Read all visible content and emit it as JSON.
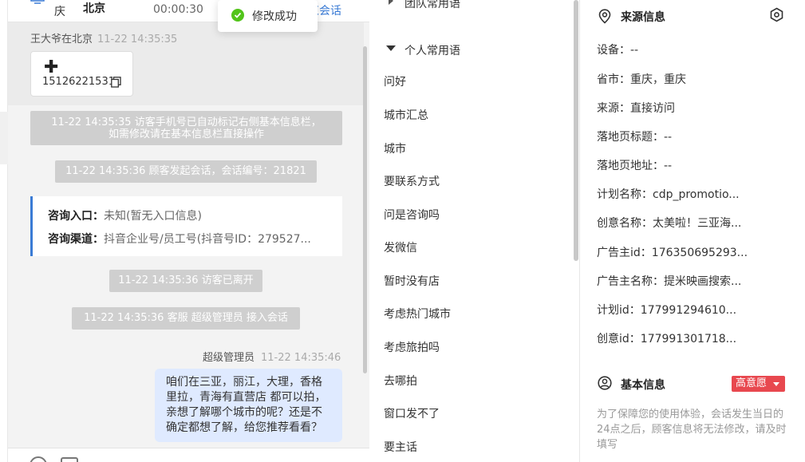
{
  "header": {
    "city_a": "庆",
    "city_b": "北京",
    "timer": "00:00:30",
    "end_chat": "束会话",
    "icon": "monitor-icon"
  },
  "toast": {
    "text": "修改成功",
    "icon": "check-circle-icon",
    "color": "#52c41a"
  },
  "chat": {
    "visitor_name": "王大爷在北京",
    "visitor_time": "11-22 14:35:35",
    "phone_card": {
      "plus": "✚",
      "number": "15126221531",
      "icon": "copy-icon"
    },
    "system_messages": [
      "11-22 14:35:35 访客手机号已自动标记右侧基本信息栏，",
      "如需修改请在基本信息栏直接操作",
      "11-22 14:35:36 顾客发起会话，会话编号：21821",
      "11-22 14:35:36 访客已离开",
      "11-22 14:35:36 客服 超级管理员 接入会话"
    ],
    "info_card": {
      "entry_label": "咨询入口：",
      "entry_value": "未知(暂无入口信息)",
      "channel_label": "咨询渠道：",
      "channel_value": "抖音企业号/员工号(抖音号ID：279527..."
    },
    "agent_name": "超级管理员",
    "agent_time": "11-22 14:35:46",
    "agent_message_lines": [
      "咱们在三亚，丽江，大理，香格",
      "里拉，青海有直营店 都可以拍，",
      "亲想了解哪个城市的呢？还是不",
      "确定都想了解，给您推荐看看？"
    ],
    "accent": "#3a7bd5",
    "bubble_color": "#dfeaff"
  },
  "phrases": {
    "team_title": "团队常用语",
    "personal_title": "个人常用语",
    "items": [
      "问好",
      "城市汇总",
      "城市",
      "要联系方式",
      "问是咨询吗",
      "发微信",
      "暂时没有店",
      "考虑热门城市",
      "考虑旅拍吗",
      "去哪拍",
      "窗口发不了",
      "要主话"
    ]
  },
  "source_info": {
    "title": "来源信息",
    "icon": "location-pin-icon",
    "settings_icon": "settings-icon",
    "fields": [
      {
        "label": "设备：",
        "value": "--"
      },
      {
        "label": "省市：",
        "value": "重庆，重庆"
      },
      {
        "label": "来源：",
        "value": "直接访问"
      },
      {
        "label": "落地页标题：",
        "value": "--"
      },
      {
        "label": "落地页地址：",
        "value": "--"
      },
      {
        "label": "计划名称：",
        "value": "cdp_promotio..."
      },
      {
        "label": "创意名称：",
        "value": "太美啦！三亚海..."
      },
      {
        "label": "广告主id：",
        "value": "176350695293..."
      },
      {
        "label": "广告主名称：",
        "value": "提米映画搜索..."
      },
      {
        "label": "计划id：",
        "value": "177991294610..."
      },
      {
        "label": "创意id：",
        "value": "177991301718..."
      }
    ]
  },
  "basic_info": {
    "title": "基本信息",
    "icon": "user-circle-icon",
    "intent_badge": "高意愿",
    "badge_color": "#e8484f",
    "note": "为了保障您的使用体验，会话发生当日的24点之后，顾客信息将无法修改，请及时填写"
  }
}
